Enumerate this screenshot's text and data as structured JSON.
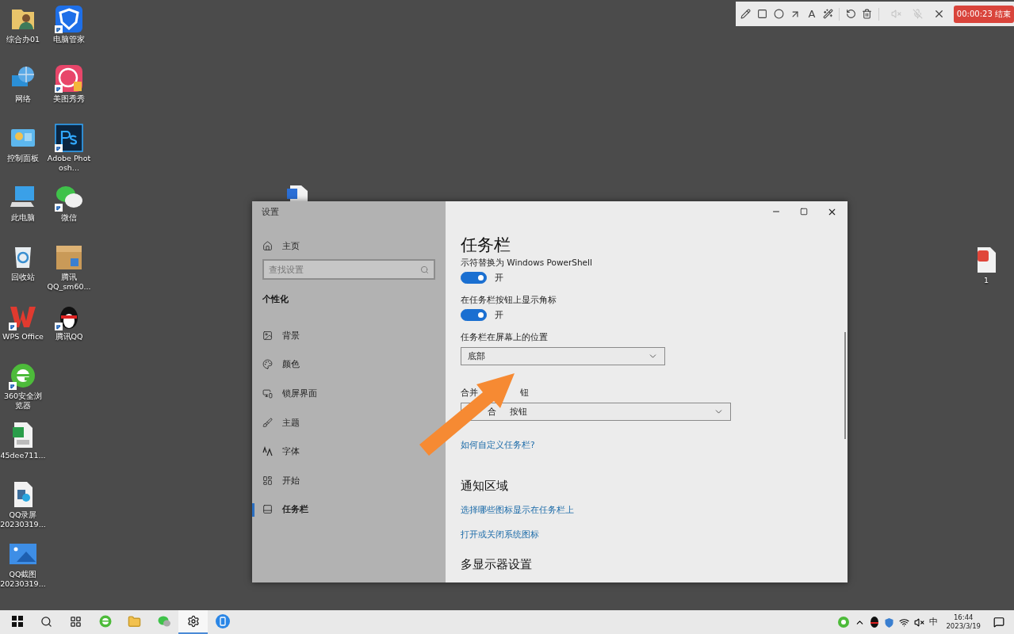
{
  "desktop_icons": [
    {
      "label": "综合办01",
      "kind": "user-folder",
      "shortcut": false
    },
    {
      "label": "网络",
      "kind": "network",
      "shortcut": false
    },
    {
      "label": "控制面板",
      "kind": "control-panel",
      "shortcut": false
    },
    {
      "label": "此电脑",
      "kind": "computer",
      "shortcut": false
    },
    {
      "label": "回收站",
      "kind": "recycle-bin",
      "shortcut": false
    },
    {
      "label": "WPS Office",
      "kind": "wps",
      "shortcut": true
    },
    {
      "label": "360安全浏览器",
      "kind": "browser",
      "shortcut": true
    },
    {
      "label": "45dee711...",
      "kind": "spreadsheet",
      "shortcut": false
    },
    {
      "label": "QQ录屏\n20230319...",
      "kind": "media-file",
      "shortcut": false
    },
    {
      "label": "QQ截图\n20230319...",
      "kind": "image-file",
      "shortcut": false
    },
    {
      "label": "电脑管家",
      "kind": "shield-app",
      "shortcut": true
    },
    {
      "label": "美图秀秀",
      "kind": "photo-app",
      "shortcut": true
    },
    {
      "label": "Adobe Photosh...",
      "kind": "ps",
      "shortcut": true
    },
    {
      "label": "微信",
      "kind": "chat",
      "shortcut": true
    },
    {
      "label": "腾讯\nQQ_sm60...",
      "kind": "package",
      "shortcut": false
    },
    {
      "label": "腾讯QQ",
      "kind": "penguin",
      "shortcut": true
    }
  ],
  "loose_icons": [
    {
      "kind": "word-file"
    },
    {
      "kind": "pdf-file",
      "label": "1"
    }
  ],
  "recorder_toolbar": {
    "text_tool": "A",
    "timer_button": "00:00:23 结束"
  },
  "settings_window": {
    "title": "设置",
    "nav": {
      "home": "主页",
      "search_placeholder": "查找设置",
      "section": "个性化",
      "items": [
        {
          "label": "背景",
          "kind": "background",
          "selected": false
        },
        {
          "label": "颜色",
          "kind": "palette",
          "selected": false
        },
        {
          "label": "锁屏界面",
          "kind": "lock-screen",
          "selected": false
        },
        {
          "label": "主题",
          "kind": "theme",
          "selected": false
        },
        {
          "label": "字体",
          "kind": "font",
          "selected": false
        },
        {
          "label": "开始",
          "kind": "start",
          "selected": false
        },
        {
          "label": "任务栏",
          "kind": "taskbar",
          "selected": true
        }
      ]
    },
    "page": {
      "heading": "任务栏",
      "items": [
        {
          "kind": "caption",
          "text": "示符替换为 Windows PowerShell"
        },
        {
          "kind": "toggle",
          "on": true,
          "state_text": "开"
        },
        {
          "kind": "caption",
          "text": "在任务栏按钮上显示角标"
        },
        {
          "kind": "toggle",
          "on": true,
          "state_text": "开"
        },
        {
          "kind": "caption",
          "text": "任务栏在屏幕上的位置"
        },
        {
          "kind": "dropdown",
          "value_parts": [
            "底部"
          ]
        },
        {
          "kind": "caption",
          "parts": [
            "合并",
            "钮"
          ]
        },
        {
          "kind": "dropdown",
          "value_parts": [
            "合",
            "按钮"
          ]
        },
        {
          "kind": "link",
          "text": "如何自定义任务栏?"
        },
        {
          "kind": "heading",
          "text": "通知区域"
        },
        {
          "kind": "link",
          "text": "选择哪些图标显示在任务栏上"
        },
        {
          "kind": "link",
          "text": "打开或关闭系统图标"
        },
        {
          "kind": "heading",
          "text": "多显示器设置"
        }
      ]
    }
  },
  "taskbar": {
    "apps": [
      {
        "kind": "start",
        "active": false
      },
      {
        "kind": "search",
        "active": false
      },
      {
        "kind": "apps-grid",
        "active": false
      },
      {
        "kind": "browser",
        "active": false
      },
      {
        "kind": "folder",
        "active": false
      },
      {
        "kind": "chat",
        "active": false
      },
      {
        "kind": "settings",
        "active": true
      },
      {
        "kind": "phone",
        "active": false
      }
    ],
    "tray": {
      "ime": "中",
      "time": "16:44",
      "date": "2023/3/19"
    }
  }
}
